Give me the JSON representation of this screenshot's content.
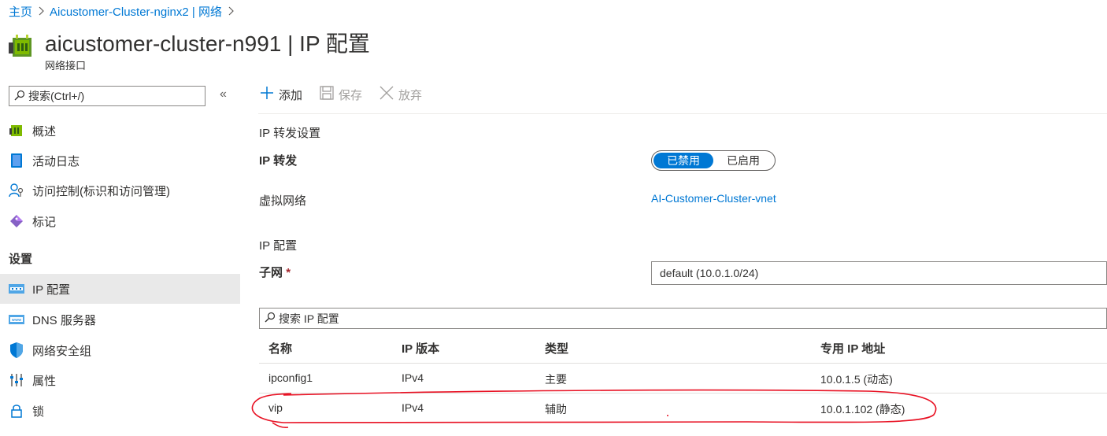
{
  "breadcrumb": {
    "home": "主页",
    "resource": "Aicustomer-Cluster-nginx2 | 网络",
    "sep": ">"
  },
  "header": {
    "title": "aicustomer-cluster-n991 | IP 配置",
    "subtitle": "网络接口",
    "icon": "network-interface-icon"
  },
  "sidebar": {
    "search_placeholder": "搜索(Ctrl+/)",
    "collapse": "«",
    "items_top": [
      {
        "label": "概述",
        "icon": "overview-icon"
      },
      {
        "label": "活动日志",
        "icon": "activity-log-icon"
      },
      {
        "label": "访问控制(标识和访问管理)",
        "icon": "access-control-icon"
      },
      {
        "label": "标记",
        "icon": "tag-icon"
      }
    ],
    "section_settings": "设置",
    "items_settings": [
      {
        "label": "IP 配置",
        "icon": "ip-config-icon",
        "active": true
      },
      {
        "label": "DNS 服务器",
        "icon": "dns-icon"
      },
      {
        "label": "网络安全组",
        "icon": "shield-icon"
      },
      {
        "label": "属性",
        "icon": "properties-icon"
      },
      {
        "label": "锁",
        "icon": "lock-icon"
      }
    ]
  },
  "toolbar": {
    "add": "添加",
    "save": "保存",
    "discard": "放弃"
  },
  "forwarding": {
    "section_title": "IP 转发设置",
    "label": "IP 转发",
    "toggle_off": "已禁用",
    "toggle_on": "已启用",
    "selected": "已禁用",
    "vnet_label": "虚拟网络",
    "vnet_link": "AI-Customer-Cluster-vnet"
  },
  "ipconfig": {
    "section_title": "IP 配置",
    "subnet_label": "子网",
    "required_mark": "*",
    "subnet_value": "default (10.0.1.0/24)",
    "search_placeholder": "搜索 IP 配置"
  },
  "table": {
    "headers": [
      "名称",
      "IP 版本",
      "类型",
      "专用 IP 地址"
    ],
    "rows": [
      [
        "ipconfig1",
        "IPv4",
        "主要",
        "10.0.1.5 (动态)"
      ],
      [
        "vip",
        "IPv4",
        "辅助",
        "10.0.1.102 (静态)"
      ]
    ]
  },
  "colors": {
    "accent": "#0078d4",
    "annotation": "#e81123",
    "active_nav_bg": "#e9e9e9"
  }
}
